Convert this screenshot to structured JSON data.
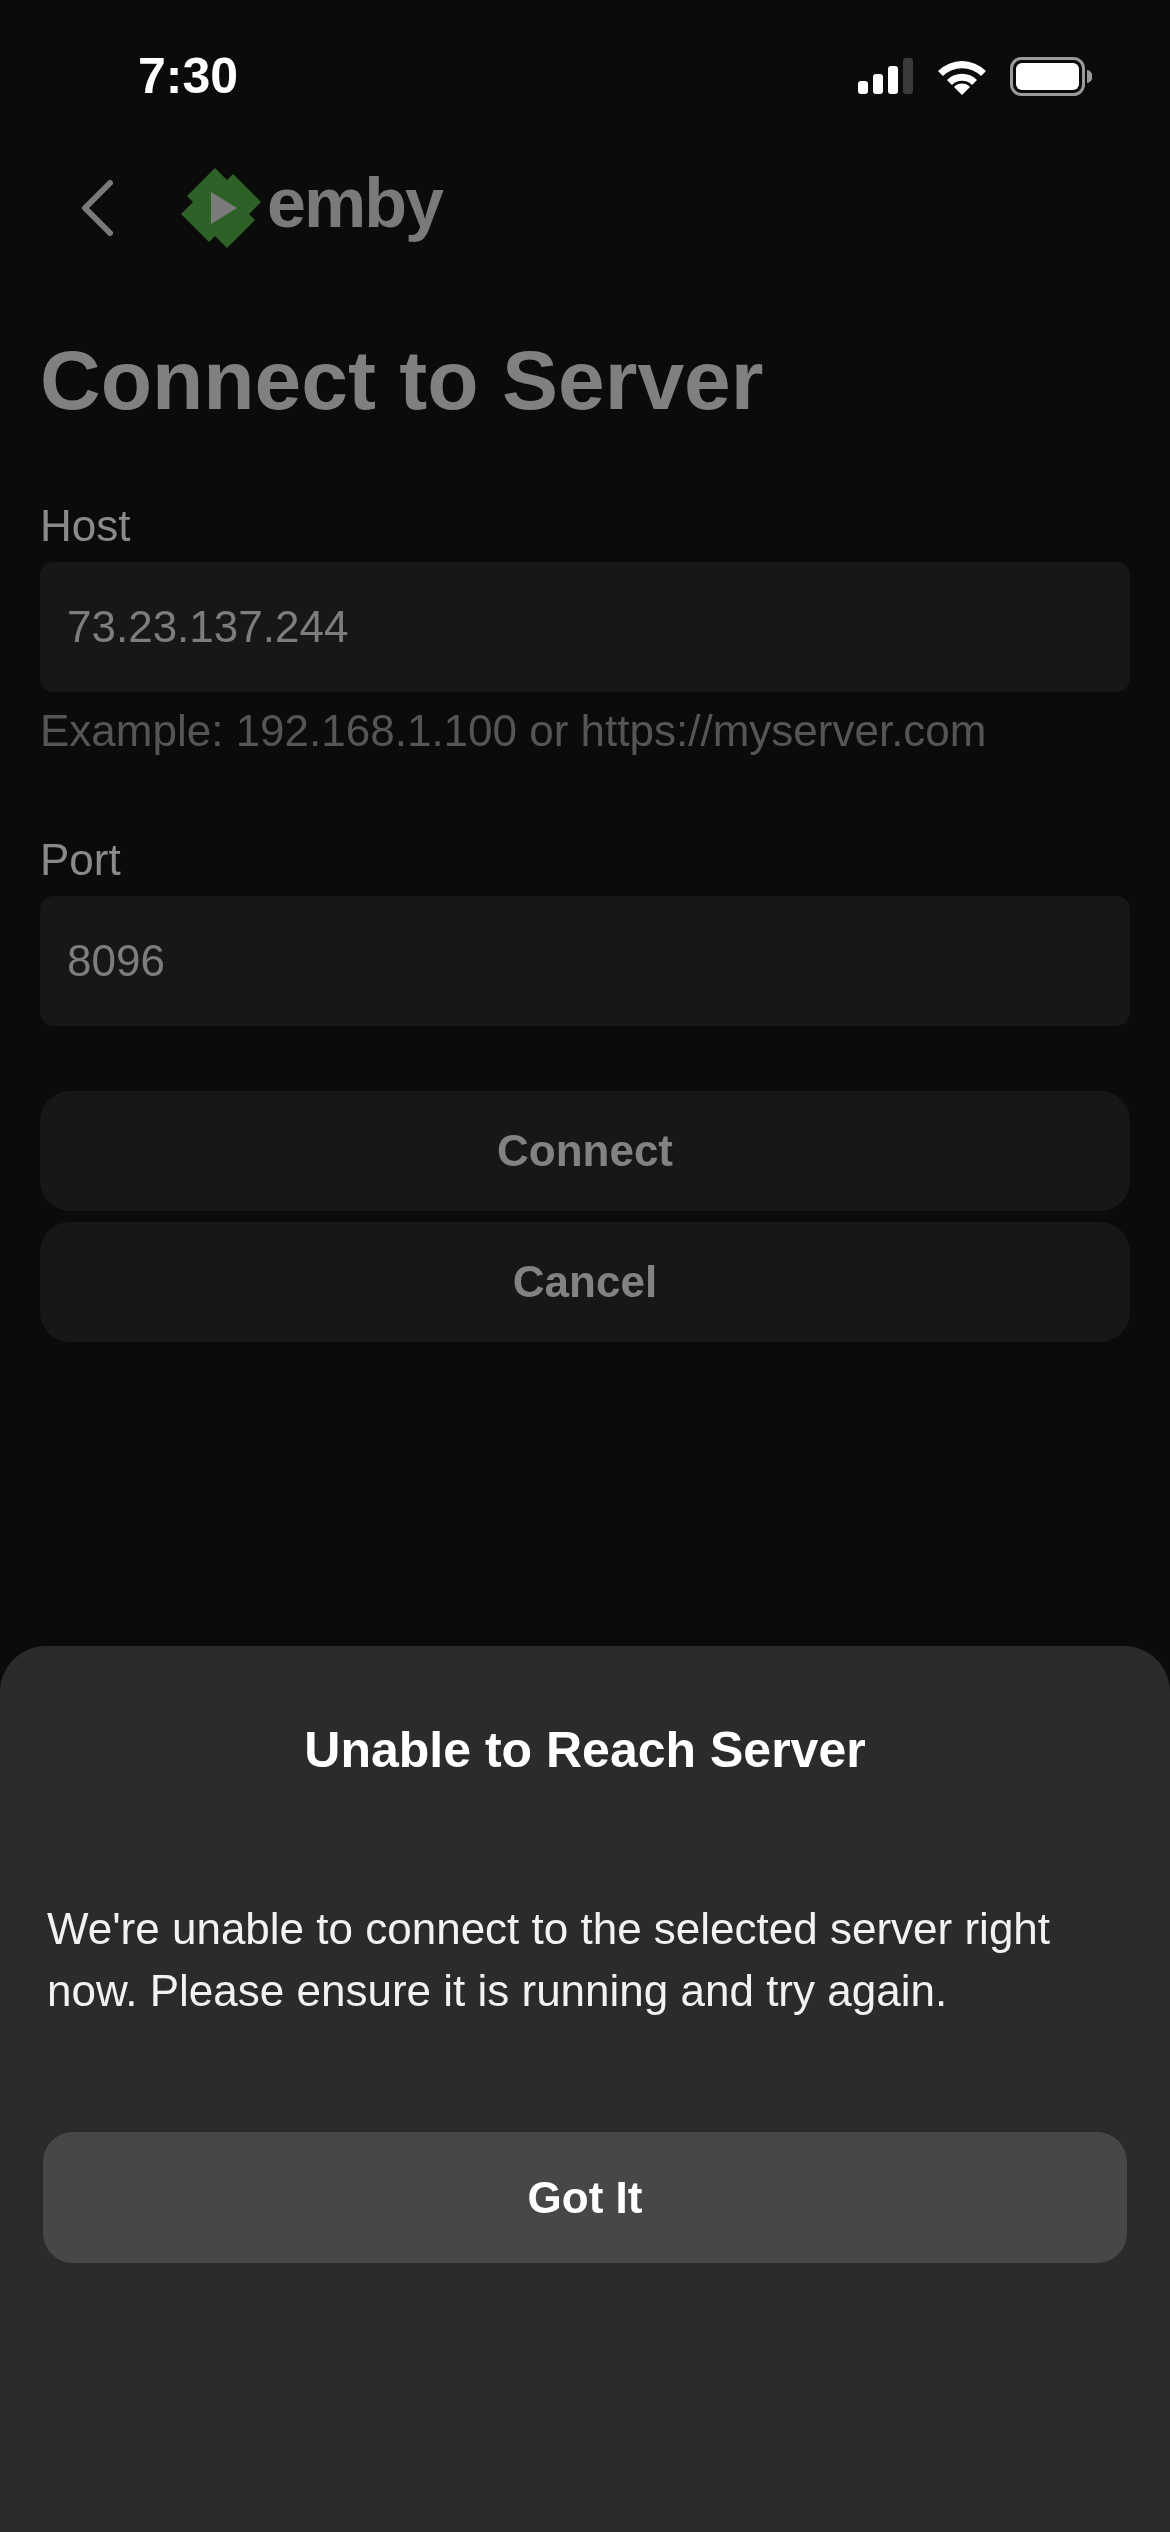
{
  "status_bar": {
    "time": "7:30"
  },
  "nav": {
    "logo_text": "emby"
  },
  "title": "Connect to Server",
  "fields": [
    {
      "label": "Host",
      "value": "73.23.137.244",
      "hint": "Example: 192.168.1.100 or https://myserver.com"
    },
    {
      "label": "Port",
      "value": "8096"
    }
  ],
  "buttons": [
    {
      "label": "Connect"
    },
    {
      "label": "Cancel"
    }
  ],
  "dialog": {
    "title": "Unable to Reach Server",
    "message": "We're unable to connect to the selected server right now. Please ensure it is running and try again.",
    "button": "Got It"
  }
}
